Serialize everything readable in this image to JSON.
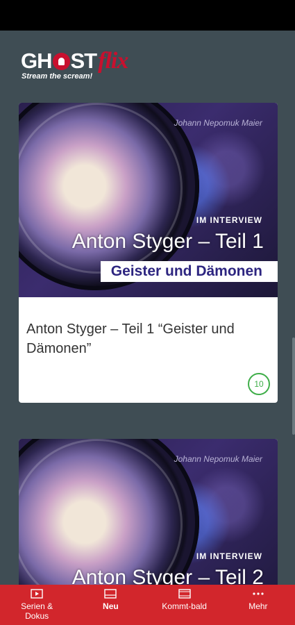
{
  "logo": {
    "ghost_text": "GH",
    "ost_text": "ST",
    "flix_text": "flix",
    "tagline": "Stream the scream!"
  },
  "cards": [
    {
      "author": "Johann Nepomuk Maier",
      "label": "IM INTERVIEW",
      "big_title": "Anton Styger – Teil 1",
      "subtitle": "Geister und Dämonen",
      "title": "Anton Styger – Teil 1 “Geister und Dämonen”",
      "badge": "10"
    },
    {
      "author": "Johann Nepomuk Maier",
      "label": "IM INTERVIEW",
      "big_title": "Anton Styger – Teil 2"
    }
  ],
  "nav": {
    "items": [
      {
        "label": "Serien & Dokus",
        "icon": "play-icon"
      },
      {
        "label": "Neu",
        "icon": "new-icon",
        "active": true
      },
      {
        "label": "Kommt-bald",
        "icon": "film-icon"
      },
      {
        "label": "Mehr",
        "icon": "more-icon"
      }
    ]
  },
  "colors": {
    "accent": "#d2262c",
    "background": "#3f4d54",
    "badge": "#3fae49"
  }
}
